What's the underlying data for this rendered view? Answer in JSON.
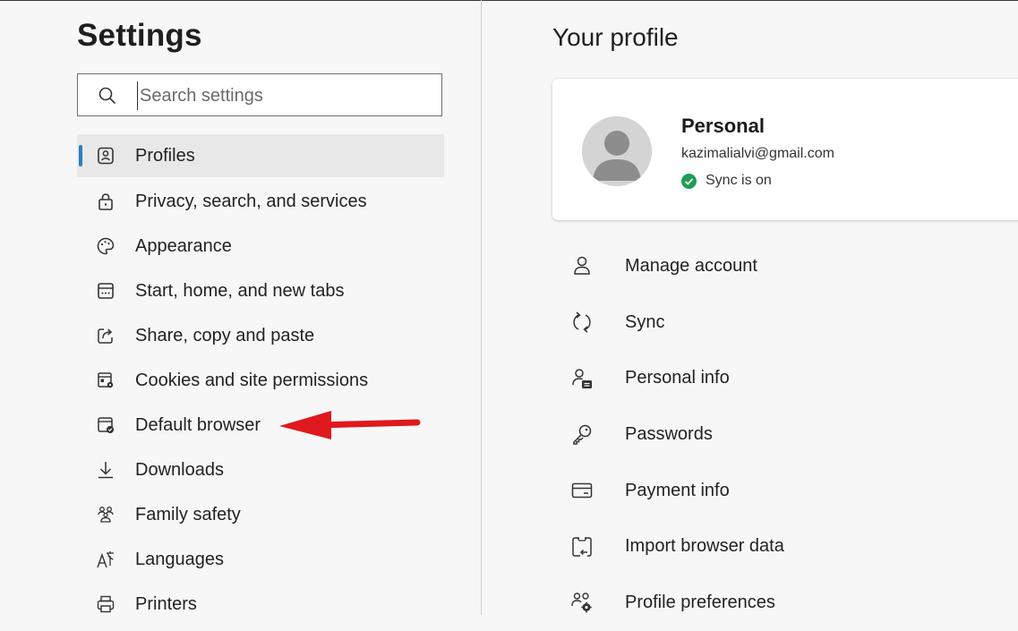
{
  "sidebar": {
    "title": "Settings",
    "search": {
      "placeholder": "Search settings",
      "value": ""
    },
    "items": [
      {
        "label": "Profiles",
        "icon": "profiles-icon",
        "active": true
      },
      {
        "label": "Privacy, search, and services",
        "icon": "lock-icon"
      },
      {
        "label": "Appearance",
        "icon": "palette-icon"
      },
      {
        "label": "Start, home, and new tabs",
        "icon": "home-tabs-icon"
      },
      {
        "label": "Share, copy and paste",
        "icon": "share-icon"
      },
      {
        "label": "Cookies and site permissions",
        "icon": "cookies-icon"
      },
      {
        "label": "Default browser",
        "icon": "default-browser-icon"
      },
      {
        "label": "Downloads",
        "icon": "download-icon"
      },
      {
        "label": "Family safety",
        "icon": "family-icon"
      },
      {
        "label": "Languages",
        "icon": "languages-icon"
      },
      {
        "label": "Printers",
        "icon": "printer-icon"
      }
    ]
  },
  "main": {
    "title": "Your profile",
    "profile": {
      "name": "Personal",
      "email": "kazimalialvi@gmail.com",
      "sync_status": "Sync is on"
    },
    "menu": [
      {
        "label": "Manage account",
        "icon": "account-icon"
      },
      {
        "label": "Sync",
        "icon": "sync-icon"
      },
      {
        "label": "Personal info",
        "icon": "personal-info-icon"
      },
      {
        "label": "Passwords",
        "icon": "key-icon"
      },
      {
        "label": "Payment info",
        "icon": "card-icon"
      },
      {
        "label": "Import browser data",
        "icon": "import-icon"
      },
      {
        "label": "Profile preferences",
        "icon": "profile-preferences-icon"
      }
    ]
  },
  "colors": {
    "accent": "#2b7fc2",
    "arrow": "#e0191e",
    "sync_check": "#1f9d55"
  }
}
